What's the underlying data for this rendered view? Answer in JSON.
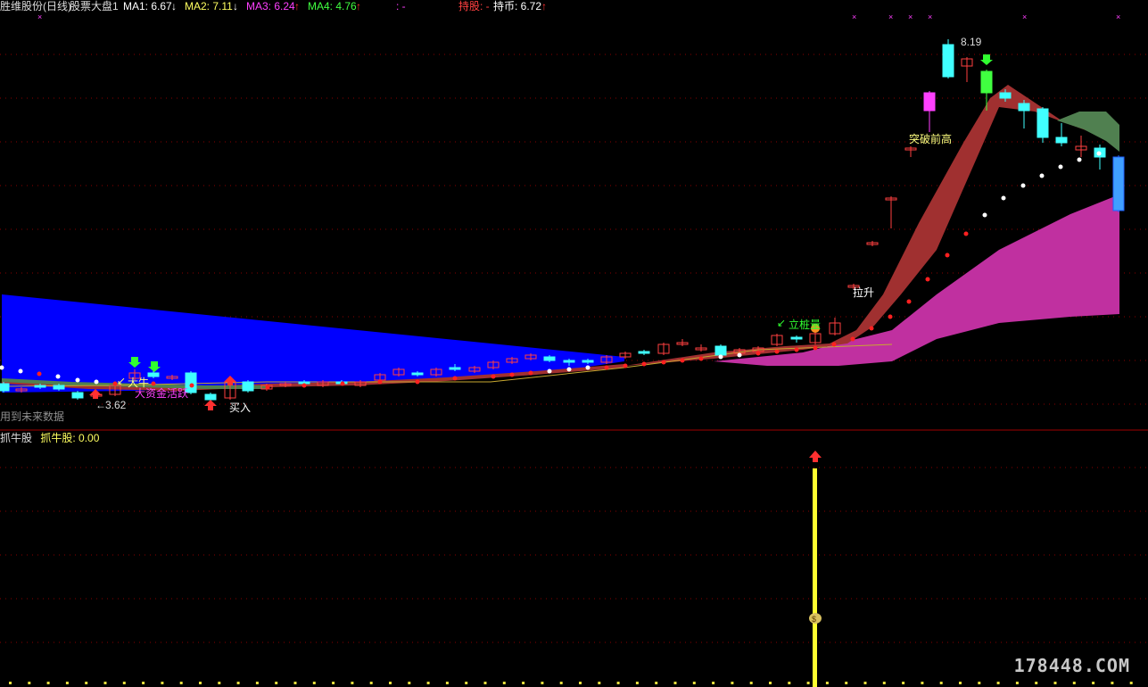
{
  "header": {
    "stock_name": "胜维股份(日线)",
    "index_name": "股票大盘1",
    "ma1": {
      "label": "MA1: 6.67",
      "dir": "↓"
    },
    "ma2": {
      "label": "MA2: 7.11",
      "dir": "↓"
    },
    "ma3": {
      "label": "MA3: 6.24",
      "dir": "↑"
    },
    "ma4": {
      "label": "MA4: 4.76",
      "dir": "↑"
    },
    "dash": ": -",
    "hold_stock": "持股: -",
    "hold_cash": "持币: 6.72",
    "hold_cash_dir": "↑"
  },
  "colors": {
    "background": "#000000",
    "ma1": "#ffffff",
    "ma2": "#ffff60",
    "ma3": "#ff40ff",
    "ma4": "#40ff40",
    "hold_stock": "#ff4040",
    "blue_band": "#0000ff",
    "red_band": "#a03030",
    "magenta_band": "#c030a0",
    "green_band": "#508050",
    "candle_up": "#ff4040",
    "candle_down": "#40ffff",
    "signal_bar": "#ffff30",
    "divider": "#a00000"
  },
  "annotations": {
    "high_price": "8.19",
    "low_price": "3.62",
    "breakout": "突破前高",
    "pull_up": "拉升",
    "pile": "立桩量",
    "big_bull": "大牛",
    "big_fund": "大资金活跃",
    "buy": "买入",
    "future_data": "用到未来数据"
  },
  "sub_panel": {
    "title": "抓牛股",
    "value_label": "抓牛股: 0.00",
    "icon": "money-bag-icon"
  },
  "watermark": "178448.COM"
}
